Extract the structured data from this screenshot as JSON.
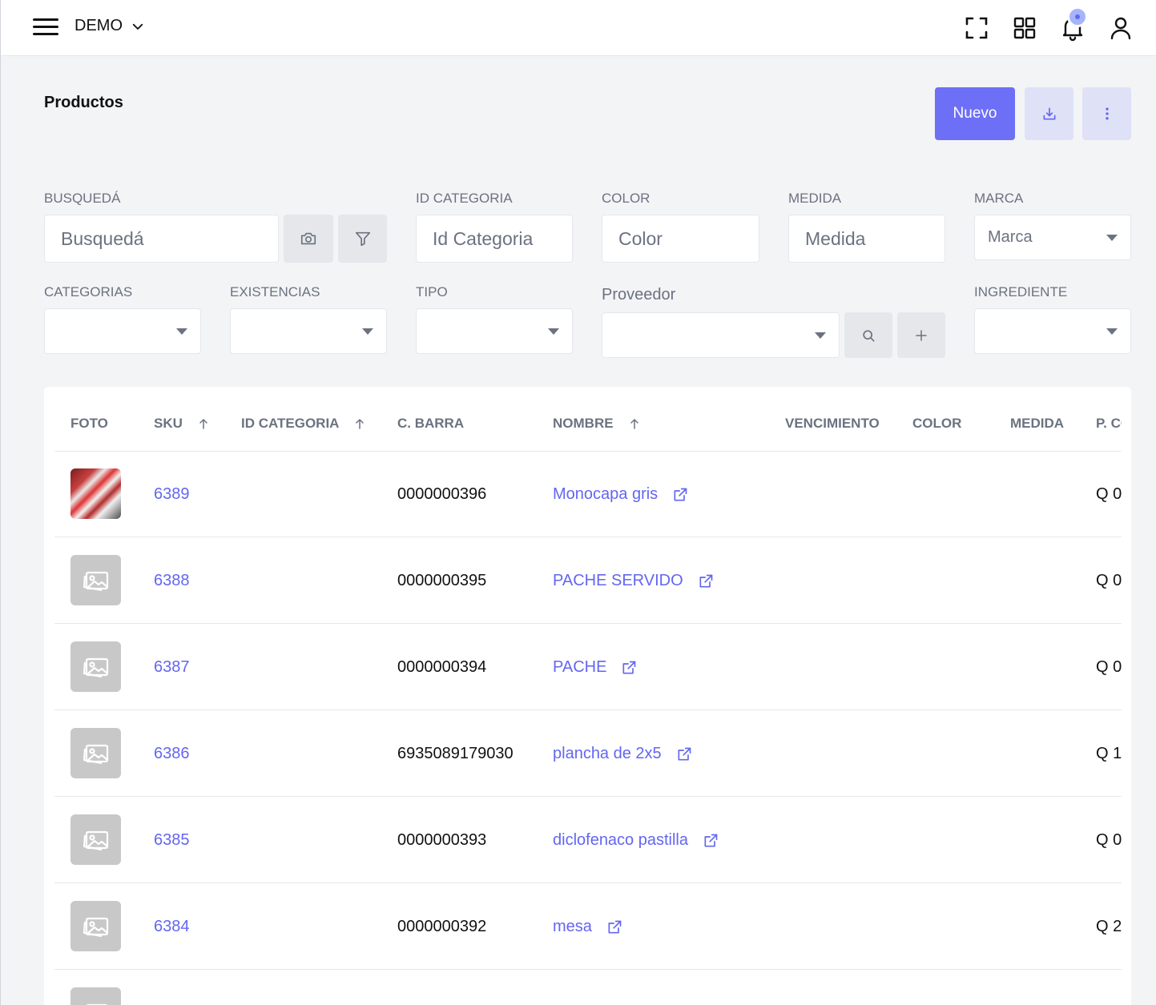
{
  "topbar": {
    "company": "DEMO",
    "icons": [
      "fullscreen-icon",
      "apps-grid-icon",
      "bell-icon",
      "user-icon"
    ]
  },
  "page": {
    "title": "Productos",
    "new_button": "Nuevo"
  },
  "filters": {
    "search": {
      "label": "BUSQUEDÁ",
      "placeholder": "Busquedá"
    },
    "category_id": {
      "label": "ID CATEGORIA",
      "placeholder": "Id Categoria"
    },
    "color": {
      "label": "COLOR",
      "placeholder": "Color"
    },
    "size": {
      "label": "MEDIDA",
      "placeholder": "Medida"
    },
    "brand": {
      "label": "MARCA",
      "value": "Marca"
    },
    "categories": {
      "label": "CATEGORIAS",
      "value": ""
    },
    "stock": {
      "label": "EXISTENCIAS",
      "value": ""
    },
    "type": {
      "label": "TIPO",
      "value": ""
    },
    "supplier": {
      "label": "Proveedor",
      "value": ""
    },
    "ingredient": {
      "label": "INGREDIENTE",
      "value": ""
    }
  },
  "table": {
    "columns": [
      "FOTO",
      "SKU",
      "ID CATEGORIA",
      "C. BARRA",
      "NOMBRE",
      "VENCIMIENTO",
      "COLOR",
      "MEDIDA",
      "P. CO"
    ],
    "rows": [
      {
        "sku": "6389",
        "barcode": "0000000396",
        "name": "Monocapa gris",
        "price": "Q 0",
        "has_photo": true
      },
      {
        "sku": "6388",
        "barcode": "0000000395",
        "name": "PACHE SERVIDO",
        "price": "Q 0",
        "has_photo": false
      },
      {
        "sku": "6387",
        "barcode": "0000000394",
        "name": "PACHE",
        "price": "Q 0",
        "has_photo": false
      },
      {
        "sku": "6386",
        "barcode": "6935089179030",
        "name": "plancha de 2x5",
        "price": "Q 1",
        "has_photo": false
      },
      {
        "sku": "6385",
        "barcode": "0000000393",
        "name": "diclofenaco pastilla",
        "price": "Q 0",
        "has_photo": false
      },
      {
        "sku": "6384",
        "barcode": "0000000392",
        "name": "mesa",
        "price": "Q 2",
        "has_photo": false
      }
    ]
  },
  "colors": {
    "accent": "#6366f1",
    "button_primary": "#6d6ff7",
    "button_light": "#dfe1f7"
  }
}
